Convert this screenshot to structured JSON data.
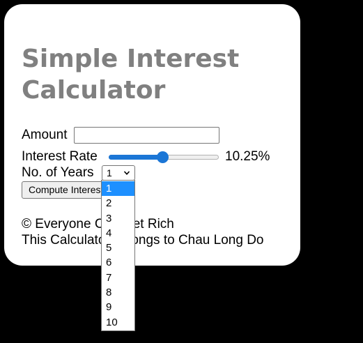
{
  "calculator": {
    "title": "Simple Interest Calculator",
    "amount_label": "Amount",
    "amount_value": "",
    "rate_label": "Interest Rate",
    "rate_value": 10.25,
    "rate_display": "10.25%",
    "rate_fraction": 0.49,
    "years_label": "No. of Years",
    "years_selected": "1",
    "years_options": [
      "1",
      "2",
      "3",
      "4",
      "5",
      "6",
      "7",
      "8",
      "9",
      "10"
    ],
    "compute_label": "Compute Interest"
  },
  "footer": {
    "copyright": "© Everyone Can Get Rich",
    "credit": "This Calculator belongs to Chau Long Do"
  },
  "colors": {
    "accent": "#1b76d6",
    "title": "#808080",
    "highlight": "#1e90ff",
    "background": "#000000",
    "card": "#ffffff"
  },
  "icons": {
    "select_arrow": "chevron-down-icon"
  }
}
